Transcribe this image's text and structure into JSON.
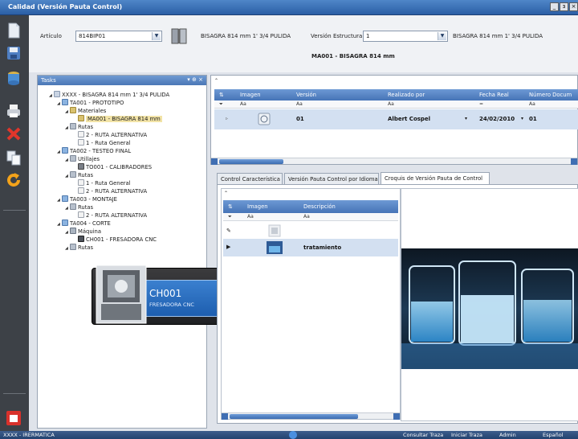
{
  "window": {
    "title": "Calidad (Versión Pauta Control)",
    "buttons": [
      "_",
      "з",
      "×"
    ]
  },
  "filters": {
    "articulo_label": "Artículo",
    "articulo_value": "814BIP01",
    "articulo_desc": "BISAGRA 814 mm 1' 3/4 PULIDA",
    "estructura_label": "Versión Estructura",
    "estructura_value": "1",
    "estructura_desc": "BISAGRA 814 mm 1' 3/4 PULIDA",
    "headline": "MA001 - BISAGRA 814 mm"
  },
  "tasks": {
    "title": "Tasks",
    "pin": "▾ ⊕ ×",
    "nodes": [
      {
        "text": "XXXX - BISAGRA 814 mm 1' 3/4 PULIDA",
        "icon": "root"
      },
      {
        "text": "TA001 - PROTOTIPO",
        "icon": "task"
      },
      {
        "text": "Materiales",
        "icon": "mat"
      },
      {
        "text": "MA001 - BISAGRA 814 mm",
        "icon": "mat"
      },
      {
        "text": "Rutas",
        "icon": "folder"
      },
      {
        "text": "2 - RUTA ALTERNATIVA",
        "icon": "doc"
      },
      {
        "text": "1 - Ruta General",
        "icon": "doc"
      },
      {
        "text": "TA002 - TESTEO FINAL",
        "icon": "task"
      },
      {
        "text": "Utillajes",
        "icon": "folder"
      },
      {
        "text": "TO001 - CALIBRADORES",
        "icon": "tool"
      },
      {
        "text": "Rutas",
        "icon": "folder"
      },
      {
        "text": "1 - Ruta General",
        "icon": "doc"
      },
      {
        "text": "2 - RUTA ALTERNATIVA",
        "icon": "doc"
      },
      {
        "text": "TA003 - MONTAJE",
        "icon": "task"
      },
      {
        "text": "Rutas",
        "icon": "folder"
      },
      {
        "text": "2 - RUTA ALTERNATIVA",
        "icon": "doc"
      },
      {
        "text": "TA004 - CORTE",
        "icon": "task"
      },
      {
        "text": "Máquina",
        "icon": "mach"
      },
      {
        "text": "CH001 - FRESADORA CNC",
        "icon": "cnc"
      },
      {
        "text": "Rutas",
        "icon": "folder"
      }
    ]
  },
  "tooltip": {
    "code": "CH001",
    "desc": "FRESADORA CNC"
  },
  "version_grid": {
    "columns": [
      "Imagen",
      "Versión",
      "Realizado por",
      "Fecha Real",
      "Número Docum"
    ],
    "filters": [
      "Aa",
      "Aa",
      "Aa",
      "=",
      "Aa"
    ],
    "row": {
      "version": "01",
      "realizado": "Albert Cospel",
      "fecha": "24/02/2010",
      "numero": "01"
    }
  },
  "tabs": [
    "Control Característica",
    "Versión Pauta Control por Idioma",
    "Croquis de Versión Pauta de Control"
  ],
  "croquis_grid": {
    "columns": [
      "Imagen",
      "Descripción"
    ],
    "filters": [
      "Aa",
      "Aa"
    ],
    "rows": [
      {
        "desc": ""
      },
      {
        "desc": "tratamiento"
      }
    ]
  },
  "status": {
    "left": "XXXX - IRERMATICA",
    "consultar": "Consultar Traza",
    "iniciar": "Iniciar Traza",
    "user": "Admin",
    "lang": "Español"
  }
}
